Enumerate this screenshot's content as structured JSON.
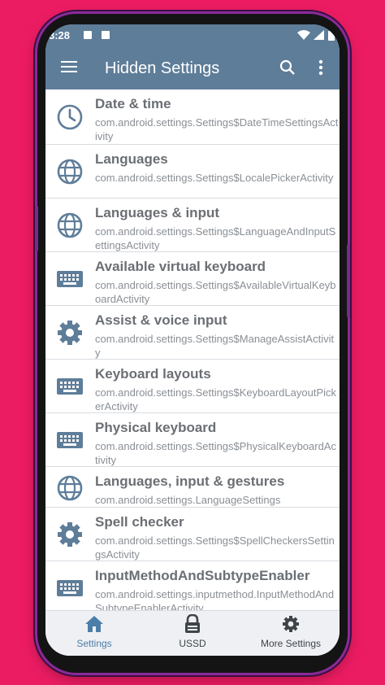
{
  "status": {
    "time": "3:28"
  },
  "appbar": {
    "title": "Hidden Settings"
  },
  "items": [
    {
      "title": "Date & time",
      "subtitle": "com.android.settings.Settings$DateTimeSettingsActivity",
      "icon": "clock-icon"
    },
    {
      "title": "Languages",
      "subtitle": "com.android.settings.Settings$LocalePickerActivity",
      "icon": "globe-icon"
    },
    {
      "title": "Languages & input",
      "subtitle": "com.android.settings.Settings$LanguageAndInputSettingsActivity",
      "icon": "globe-icon"
    },
    {
      "title": "Available virtual keyboard",
      "subtitle": "com.android.settings.Settings$AvailableVirtualKeyboardActivity",
      "icon": "keyboard-icon"
    },
    {
      "title": "Assist & voice input",
      "subtitle": "com.android.settings.Settings$ManageAssistActivity",
      "icon": "gear-icon"
    },
    {
      "title": "Keyboard layouts",
      "subtitle": "com.android.settings.Settings$KeyboardLayoutPickerActivity",
      "icon": "keyboard-icon"
    },
    {
      "title": "Physical keyboard",
      "subtitle": "com.android.settings.Settings$PhysicalKeyboardActivity",
      "icon": "keyboard-icon"
    },
    {
      "title": "Languages, input & gestures",
      "subtitle": "com.android.settings.LanguageSettings",
      "icon": "globe-icon"
    },
    {
      "title": "Spell checker",
      "subtitle": "com.android.settings.Settings$SpellCheckersSettingsActivity",
      "icon": "gear-icon"
    },
    {
      "title": "InputMethodAndSubtypeEnabler",
      "subtitle": "com.android.settings.inputmethod.InputMethodAndSubtypeEnablerActivity",
      "icon": "keyboard-icon"
    }
  ],
  "nav": [
    {
      "label": "Settings",
      "icon": "home-icon",
      "active": true
    },
    {
      "label": "USSD",
      "icon": "lock-icon",
      "active": false
    },
    {
      "label": "More Settings",
      "icon": "gear-icon",
      "active": false
    }
  ],
  "colors": {
    "accent": "#5e7d99",
    "icon": "#5e7d99",
    "active_nav": "#4d7ea8",
    "background": "#ec1c63"
  }
}
